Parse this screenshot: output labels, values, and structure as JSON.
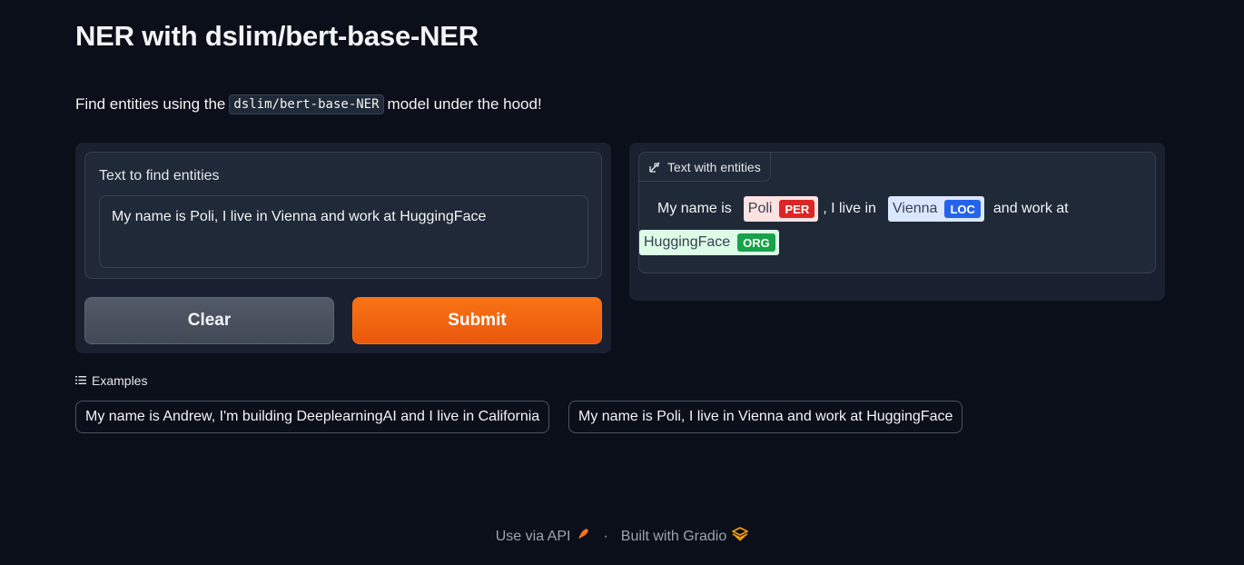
{
  "page": {
    "title": "NER with dslim/bert-base-NER",
    "description_prefix": "Find entities using the",
    "description_code": "dslim/bert-base-NER",
    "description_suffix": "model under the hood!"
  },
  "input": {
    "label": "Text to find entities",
    "value": "My name is Poli, I live in Vienna and work at HuggingFace"
  },
  "buttons": {
    "clear_label": "Clear",
    "submit_label": "Submit"
  },
  "output": {
    "label": "Text with entities",
    "icon": "highlight-text-icon",
    "segments": [
      {
        "text": "My name is",
        "entity": null
      },
      {
        "text": "Poli",
        "entity": "PER"
      },
      {
        "text": ", I live in",
        "entity": null
      },
      {
        "text": "Vienna",
        "entity": "LOC"
      },
      {
        "text": "and work at",
        "entity": null
      },
      {
        "text": "HuggingFace",
        "entity": "ORG"
      }
    ],
    "entity_colors": {
      "PER": "#dc2626",
      "LOC": "#2563eb",
      "ORG": "#16a34a"
    }
  },
  "examples": {
    "label": "Examples",
    "items": [
      "My name is Andrew, I'm building DeeplearningAI and I live in California",
      "My name is Poli, I live in Vienna and work at HuggingFace"
    ]
  },
  "footer": {
    "api_label": "Use via API",
    "separator": "·",
    "built_label": "Built with Gradio"
  },
  "colors": {
    "background": "#0b0f19",
    "accent": "#f97316"
  }
}
